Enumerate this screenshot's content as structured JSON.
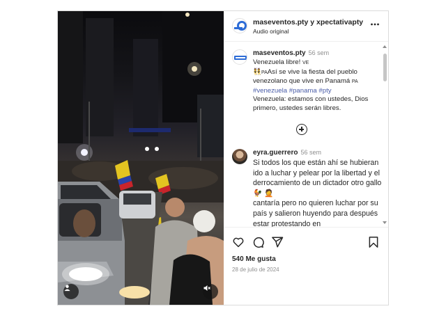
{
  "post": {
    "header": {
      "username": "maseventos.pty y xpectativapty",
      "audio": "Audio original",
      "more_icon": "more-horizontal-icon"
    },
    "caption": {
      "username": "maseventos.pty",
      "age": "56 sem",
      "line1": "Venezuela libre! ",
      "line1_flag": "VE",
      "line2_flag": "PA",
      "line2": "Así se vive la fiesta del pueblo venezolano que vive en Panamá ",
      "line2_flag_end": "PA",
      "hashtags": "#venezuela #panama #pty",
      "line3": "Venezuela: estamos con ustedes, Dios primero, ustedes serán libres."
    },
    "load_more_icon": "plus-circle-icon",
    "comment": {
      "username": "eyra.guerrero",
      "age": "56 sem",
      "text_a": "Si todos los que están ahí se hubieran ido a luchar y pelear por la libertad y el derrocamiento de un dictador otro gallo ",
      "text_b": "cantaría pero no quieren luchar por su país y salieron huyendo para después estar protestando en"
    },
    "actions": {
      "like_icon": "heart-icon",
      "comment_icon": "comment-icon",
      "share_icon": "send-icon",
      "save_icon": "bookmark-icon"
    },
    "likes": "540 Me gusta",
    "date": "28 de julio de 2024"
  },
  "media": {
    "user_tag_icon": "user-tag-icon",
    "mute_icon": "muted-speaker-icon"
  },
  "colors": {
    "hashtag": "#4a5da8",
    "muted_text": "#8e8e8e",
    "border": "#dbdbdb"
  }
}
